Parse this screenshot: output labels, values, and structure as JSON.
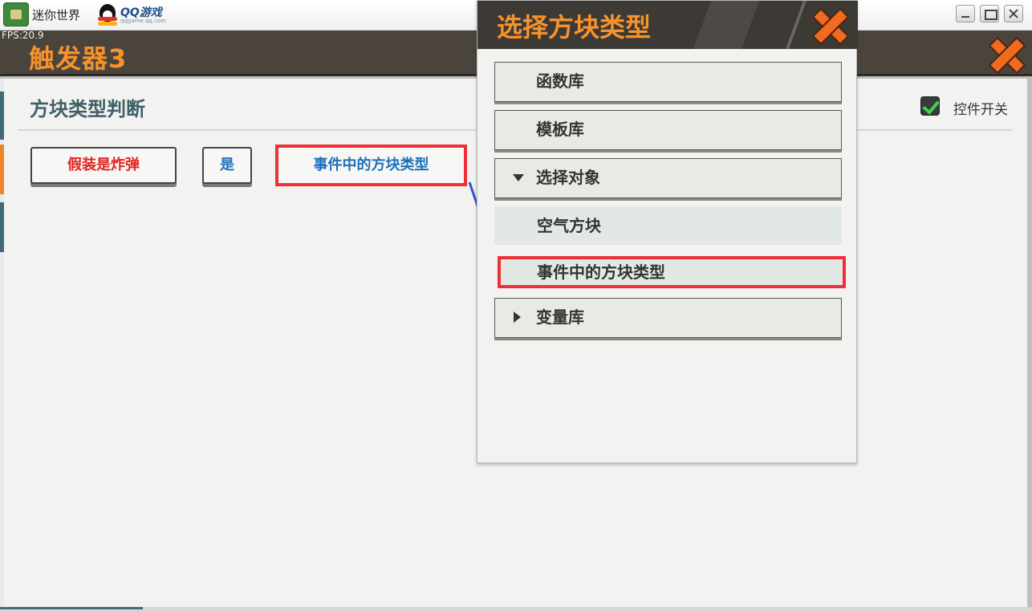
{
  "window": {
    "app_name": "迷你世界",
    "partner_logo": "QQ游戏",
    "partner_sub": "qqgame.qq.com",
    "fps": "FPS:20.9",
    "controls": [
      "minimize-icon",
      "maximize-icon",
      "close-icon"
    ]
  },
  "panel": {
    "title": "触发器3",
    "section_title": "方块类型判断",
    "switch_label": "控件开关",
    "switch_checked": true,
    "buttons": {
      "fake": "假装是炸弹",
      "yes": "是",
      "event_block": "事件中的方块类型"
    }
  },
  "popup": {
    "title": "选择方块类型",
    "items": [
      {
        "label": "函数库"
      },
      {
        "label": "模板库"
      },
      {
        "label": "选择对象",
        "expanded": true
      },
      {
        "label": "变量库",
        "expanded": false
      }
    ],
    "sub_items": [
      {
        "label": "空气方块"
      },
      {
        "label": "事件中的方块类型",
        "highlighted": true
      }
    ]
  },
  "colors": {
    "accent_orange": "#f6922c",
    "header_dark": "#4a443d",
    "highlight_red": "#ee3039",
    "link_blue": "#1e6fb8",
    "warning_red": "#e2241f",
    "arrow_blue": "#2f55d4"
  }
}
